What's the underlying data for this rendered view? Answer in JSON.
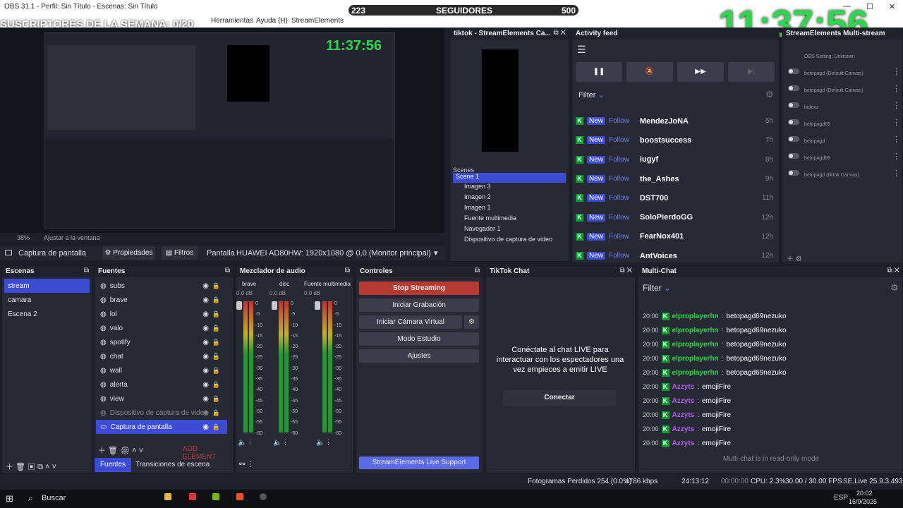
{
  "window": {
    "title": "OBS 31.1 - Perfil: Sin Título - Escenas: Sin Título",
    "minimize": "—",
    "maximize": "☐",
    "close": "✕"
  },
  "menu": [
    "Herramientas",
    "Ayuda (H)",
    "StreamElements"
  ],
  "overlay": {
    "suscriptores": "SUSCRIPTORES DE LA SEMANA: 0/20",
    "followers_left": "223",
    "followers_label": "SEGUIDORES",
    "followers_right": "500",
    "clock": "11:37:56"
  },
  "preview_bar": {
    "zoom": "38%",
    "fit": "Ajustar a la ventana"
  },
  "source_toolbar": {
    "source": "Captura de pantalla",
    "properties": "Propiedades",
    "filters": "Filtros",
    "screen_label": "Pantalla",
    "screen_value": "HUAWEI AD80HW: 1920x1080 @ 0,0 (Monitor principal)"
  },
  "scenes": {
    "title": "Escenas",
    "items": [
      "stream",
      "camara",
      "Escena 2"
    ]
  },
  "sources": {
    "title": "Fuentes",
    "items": [
      "subs",
      "brave",
      "lol",
      "valo",
      "spotify",
      "chat",
      "wall",
      "alerta",
      "view",
      "Dispositivo de captura de video",
      "Captura de pantalla"
    ],
    "add": "ADD ELEMENT",
    "tab_sources": "Fuentes",
    "tab_transitions": "Transiciones de escena"
  },
  "mixer": {
    "title": "Mezclador de audio",
    "channels": [
      {
        "name": "brave",
        "db": "0.0 dB"
      },
      {
        "name": "disc",
        "db": "0.0 dB"
      },
      {
        "name": "Fuente multimedia",
        "db": "0.0 dB"
      }
    ],
    "scale": [
      "0",
      "-5",
      "-10",
      "-15",
      "-20",
      "-25",
      "-30",
      "-35",
      "-40",
      "-45",
      "-50",
      "-55",
      "-60"
    ]
  },
  "controls": {
    "title": "Controles",
    "stop": "Stop Streaming",
    "record": "Iniciar Grabación",
    "vcam": "Iniciar Cámara Virtual",
    "studio": "Modo Estudio",
    "settings": "Ajustes",
    "support": "StreamElements Live Support"
  },
  "tiktok_chat": {
    "title": "TikTok Chat",
    "message": "Conéctate al chat LIVE para interactuar con los espectadores una vez empieces a emitir LIVE",
    "connect": "Conectar"
  },
  "multichat": {
    "title": "Multi-Chat",
    "filter": "Filter",
    "messages": [
      {
        "time": "20:00",
        "user": "elproplayerhn",
        "text": "betopagd69nezuko",
        "color": "#2bd84a"
      },
      {
        "time": "20:00",
        "user": "elproplayerhn",
        "text": "betopagd69nezuko",
        "color": "#2bd84a"
      },
      {
        "time": "20:00",
        "user": "elproplayerhn",
        "text": "betopagd69nezuko",
        "color": "#2bd84a"
      },
      {
        "time": "20:00",
        "user": "elproplayerhn",
        "text": "betopagd69nezuko",
        "color": "#2bd84a"
      },
      {
        "time": "20:00",
        "user": "elproplayerhn",
        "text": "betopagd69nezuko",
        "color": "#2bd84a"
      },
      {
        "time": "20:00",
        "user": "Azzyts",
        "text": "emojiFire",
        "color": "#b55cf0"
      },
      {
        "time": "20:00",
        "user": "Azzyts",
        "text": "emojiFire",
        "color": "#b55cf0"
      },
      {
        "time": "20:00",
        "user": "Azzyts",
        "text": "emojiFire",
        "color": "#b55cf0"
      },
      {
        "time": "20:00",
        "user": "Azzyts",
        "text": "emojiFire",
        "color": "#b55cf0"
      },
      {
        "time": "20:00",
        "user": "Azzyts",
        "text": "emojiFire",
        "color": "#b55cf0"
      }
    ],
    "readonly": "Multi-chat is in read-only mode"
  },
  "tiktok_dock": {
    "title": "tiktok - StreamElements Ca...",
    "scenes_title": "Scenes",
    "scenes": [
      "Scene 1",
      "Imagen 3",
      "Imagen 2",
      "Imagen 1",
      "Fuente multimedia",
      "Navegador 1",
      "Dispositivo de captura de video"
    ]
  },
  "activity": {
    "title": "Activity feed",
    "filter": "Filter",
    "items": [
      {
        "name": "MendezJoNA",
        "time": "5h"
      },
      {
        "name": "boostsuccess",
        "time": "7h"
      },
      {
        "name": "iugyf",
        "time": "8h"
      },
      {
        "name": "the_Ashes",
        "time": "9h"
      },
      {
        "name": "DST700",
        "time": "11h"
      },
      {
        "name": "SoloPierdoGG",
        "time": "12h"
      },
      {
        "name": "FearNox401",
        "time": "12h"
      },
      {
        "name": "AntVoices",
        "time": "12h"
      }
    ],
    "new": "New",
    "follow": "Follow"
  },
  "multistream": {
    "title": "StreamElements Multi-stream",
    "items": [
      "OBS Setting: Unknown",
      "betopagd (Default Canvas)",
      "betopagd (Default Canvas)",
      "ladexz",
      "betopagd69",
      "betopagd",
      "betopagd69",
      "betopagd (tiktok Canvas)"
    ]
  },
  "status": {
    "frames": "Fotogramas Perdidos 254 (0.0%)",
    "kbps": "4786 kbps",
    "live_time": "24:13:12",
    "rec_time": "00:00:00",
    "cpu": "CPU: 2.3%",
    "fps": "30.00 / 30.00 FPS",
    "version": "SE.Live 25.9.3.493"
  },
  "taskbar": {
    "search": "Buscar",
    "lang": "ESP",
    "time": "20:02",
    "date": "16/9/2025"
  },
  "colors": {
    "accent": "#3c4bd6",
    "stop": "#b73a32",
    "green": "#2bd84a",
    "purple": "#b55cf0"
  }
}
